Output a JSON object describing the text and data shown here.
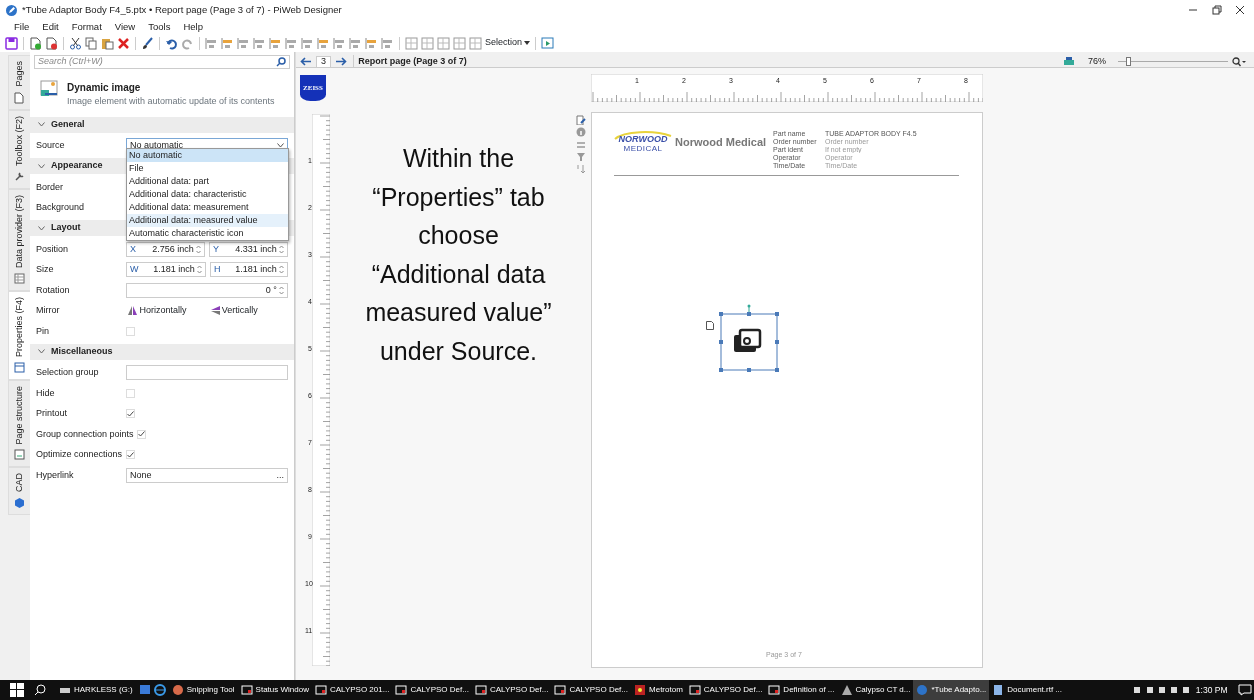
{
  "window": {
    "title": "*Tube Adaptor Body F4_5.ptx • Report page (Page 3 of 7) - PiWeb Designer"
  },
  "menu": [
    "File",
    "Edit",
    "Format",
    "View",
    "Tools",
    "Help"
  ],
  "toolbar": {
    "selection_label": "Selection"
  },
  "side_tabs": [
    {
      "label": "Pages",
      "selected": false
    },
    {
      "label": "Toolbox (F2)",
      "selected": false
    },
    {
      "label": "Data provider (F3)",
      "selected": false
    },
    {
      "label": "Properties (F4)",
      "selected": true
    },
    {
      "label": "Page structure",
      "selected": false
    },
    {
      "label": "CAD",
      "selected": false
    }
  ],
  "search": {
    "placeholder": "Search (Ctrl+W)"
  },
  "element": {
    "title": "Dynamic image",
    "description": "Image element with automatic update of its contents"
  },
  "sections": [
    {
      "title": "General",
      "expanded": true,
      "rows": [
        {
          "label": "Source",
          "kind": "select",
          "value": "No automatic"
        }
      ]
    },
    {
      "title": "Appearance",
      "expanded": true,
      "rows": [
        {
          "label": "Border",
          "kind": "blank"
        },
        {
          "label": "Background",
          "kind": "blank"
        }
      ]
    },
    {
      "title": "Layout",
      "expanded": true,
      "rows": [
        {
          "label": "Position",
          "kind": "pair",
          "a_label": "X",
          "a_value": "2.756 inch",
          "b_label": "Y",
          "b_value": "4.331 inch"
        },
        {
          "label": "Size",
          "kind": "pair",
          "a_label": "W",
          "a_value": "1.181 inch",
          "b_label": "H",
          "b_value": "1.181 inch"
        },
        {
          "label": "Rotation",
          "kind": "spin",
          "value": "0 °"
        },
        {
          "label": "Mirror",
          "kind": "mirror",
          "a_label": "Horizontally",
          "b_label": "Vertically"
        },
        {
          "label": "Pin",
          "kind": "check",
          "checked": false
        }
      ]
    },
    {
      "title": "Miscellaneous",
      "expanded": true,
      "rows": [
        {
          "label": "Selection group",
          "kind": "text"
        },
        {
          "label": "Hide",
          "kind": "check",
          "checked": false
        },
        {
          "label": "Printout",
          "kind": "check",
          "checked": true
        },
        {
          "label": "Group connection points",
          "kind": "check",
          "checked": true
        },
        {
          "label": "Optimize connections",
          "kind": "check",
          "checked": true
        },
        {
          "label": "Hyperlink",
          "kind": "link",
          "value": "None",
          "button": "..."
        }
      ]
    }
  ],
  "dropdown": {
    "options": [
      {
        "label": "No automatic",
        "selected": true,
        "hovered": false
      },
      {
        "label": "File",
        "selected": false,
        "hovered": false
      },
      {
        "label": "Additional data: part",
        "selected": false,
        "hovered": false
      },
      {
        "label": "Additional data: characteristic",
        "selected": false,
        "hovered": false
      },
      {
        "label": "Additional data: measurement",
        "selected": false,
        "hovered": false
      },
      {
        "label": "Additional data: measured value",
        "selected": false,
        "hovered": true
      },
      {
        "label": "Automatic characteristic icon",
        "selected": false,
        "hovered": false
      }
    ]
  },
  "navigator": {
    "page": "3",
    "title": "Report page (Page 3 of 7)",
    "zoom": "76%"
  },
  "zoom_slider": {
    "level": 0.08
  },
  "logo": {
    "text": "ZEISS"
  },
  "ruler": {
    "h_labels": [
      "1",
      "2",
      "3",
      "4",
      "5",
      "6",
      "7",
      "8"
    ],
    "v_labels": [
      "1",
      "2",
      "3",
      "4",
      "5",
      "6",
      "7",
      "8",
      "9",
      "10",
      "11"
    ]
  },
  "annotation": {
    "lines": [
      "Within the",
      "“Properties” tab",
      "choose",
      "“Additional data",
      "measured value”",
      "under Source."
    ]
  },
  "report": {
    "brand_mark": "NORWOOD",
    "brand_sub": "MEDICAL",
    "company": "Norwood Medical",
    "fields": [
      {
        "label": "Part name",
        "value": "TUBE ADAPTOR BODY F4.5"
      },
      {
        "label": "Order number",
        "placeholder": "Order number"
      },
      {
        "label": "Part ident",
        "placeholder": "If not empty"
      },
      {
        "label": "Operator",
        "placeholder": "Operator"
      },
      {
        "label": "Time/Date",
        "placeholder": "Time/Date"
      }
    ],
    "footer": "Page 3 of 7"
  },
  "taskbar": {
    "items": [
      {
        "label": "HARKLESS (G:)",
        "active": false
      },
      {
        "active": false
      },
      {
        "label": "Snipping Tool",
        "active": false
      },
      {
        "label": "Status Window",
        "active": false
      },
      {
        "label": "CALYPSO 201...",
        "active": false
      },
      {
        "label": "CALYPSO Def...",
        "active": false
      },
      {
        "label": "CALYPSO Def...",
        "active": false
      },
      {
        "label": "CALYPSO Def...",
        "active": false
      },
      {
        "label": "Metrotom",
        "active": false
      },
      {
        "label": "CALYPSO Def...",
        "active": false
      },
      {
        "label": "Definition of ...",
        "active": false
      },
      {
        "label": "Calypso CT d...",
        "active": false
      },
      {
        "label": "*Tube Adapto...",
        "active": true
      },
      {
        "label": "Document.rtf ...",
        "active": false
      }
    ],
    "time": "1:30 PM"
  }
}
